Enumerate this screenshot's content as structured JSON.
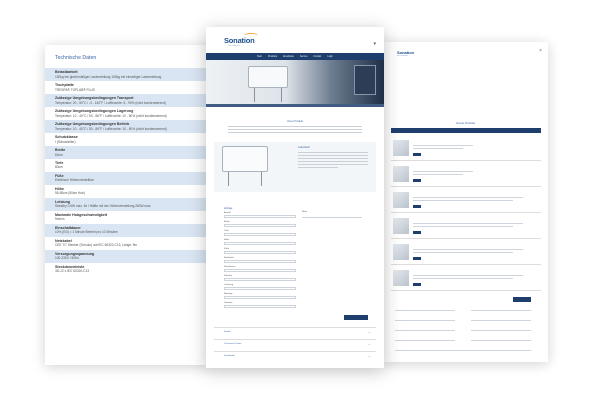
{
  "left_page": {
    "title": "Technische Daten",
    "specs": [
      {
        "label": "Belastbarkeit",
        "value": "150kg bei gleichmäßiger Lastverteilung 150kg bei einseitiger Lastverteilung"
      },
      {
        "label": "Tischplatte",
        "value": "TRESPA® TOPLAB® PLUS"
      },
      {
        "label": "Zulässige Umgebungsbedingungen Transport",
        "value": "Temperatur: 20 - 50°C / -4 - 140°F / Luftfeuchte: 5 - 90% (nicht kondensierend)"
      },
      {
        "label": "Zulässige Umgebungsbedingungen Lagerung",
        "value": "Temperatur: 10 - 40°C / 50 - 86°F / Luftfeuchte: 10 - 80% (nicht kondensierend)"
      },
      {
        "label": "Zulässige Umgebungsbedingungen Betrieb",
        "value": "Temperatur: 10 - 40°C / 50 - 86°F / Luftfeuchte: 10 - 80% (nicht kondensierend)"
      },
      {
        "label": "Schutzklasse",
        "value": "I (Schutzleiter)"
      },
      {
        "label": "Breite",
        "value": "60cm"
      },
      {
        "label": "Tiefe",
        "value": "80cm"
      },
      {
        "label": "Füße",
        "value": "Elektrisch Höhenverstellbar"
      },
      {
        "label": "Höhe",
        "value": "55-65cm (50cm Hub)"
      },
      {
        "label": "Leistung",
        "value": "Standby 0,6W max. 6x / Hälfte mit der Höhenverstellung 280W max."
      },
      {
        "label": "Maximale Hubgeschwindigkeit",
        "value": "9mm/s"
      },
      {
        "label": "Einschaltdauer",
        "value": "10% (ED) = 1 Minute Betrieb pro 10 Minuten"
      },
      {
        "label": "Netzkabel",
        "value": "CEE 7/7 Stecker (Schuko) auf IEC 60320-C13, Länge: 5m"
      },
      {
        "label": "Versorgungsspannung",
        "value": "100-230V / 50Hz"
      },
      {
        "label": "Steckdosenleiste",
        "value": "3D-12 x IEC 60320-C13"
      }
    ]
  },
  "center_page": {
    "logo": {
      "name": "Sonation",
      "tag": "lab solutions"
    },
    "nav": [
      "Start",
      "Produkte",
      "Ersatzteile",
      "Service",
      "Kontakt",
      "Login"
    ],
    "intro_title": "Unser Produkt",
    "feature_title": "Labortisch",
    "request_title": "Anfrage",
    "request_rows": [
      "Anzahl",
      "Breite",
      "Tiefe",
      "Höhe",
      "Füße",
      "Netzkabel",
      "Steckdosen",
      "Zubehör",
      "Lieferung",
      "Montage",
      "Garantie"
    ],
    "notes_label": "Notiz",
    "accordions": [
      "Details",
      "Technische Daten",
      "Downloads"
    ]
  },
  "right_page": {
    "logo": {
      "name": "Sonation",
      "tag": "lab solutions"
    },
    "banner_title": "Unsere Produkte"
  }
}
